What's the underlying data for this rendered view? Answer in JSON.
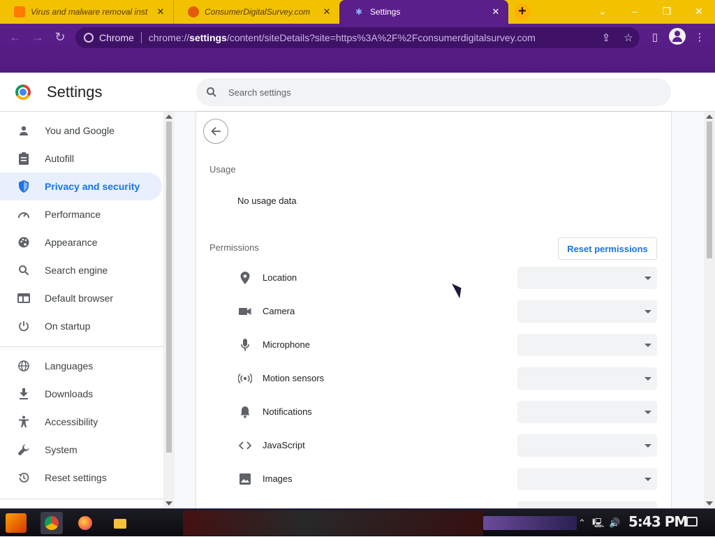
{
  "tabs": [
    {
      "title": "Virus and malware removal inst",
      "color": "#ff7a00",
      "active": false
    },
    {
      "title": "ConsumerDigitalSurvey.com",
      "color": "#e35a0a",
      "active": false
    },
    {
      "title": "Settings",
      "color": "#4285f4",
      "active": true
    }
  ],
  "new_tab_label": "+",
  "omnibox": {
    "chip": "Chrome",
    "url_prefix": "chrome://",
    "url_bold": "settings",
    "url_suffix": "/content/siteDetails?site=https%3A%2F%2Fconsumerdigitalsurvey.com"
  },
  "settings_header": {
    "title": "Settings",
    "search_placeholder": "Search settings"
  },
  "nav": {
    "items": [
      {
        "label": "You and Google",
        "icon": "person-icon"
      },
      {
        "label": "Autofill",
        "icon": "clipboard-icon"
      },
      {
        "label": "Privacy and security",
        "icon": "shield-icon",
        "active": true
      },
      {
        "label": "Performance",
        "icon": "gauge-icon"
      },
      {
        "label": "Appearance",
        "icon": "palette-icon"
      },
      {
        "label": "Search engine",
        "icon": "search-icon"
      },
      {
        "label": "Default browser",
        "icon": "browser-icon"
      },
      {
        "label": "On startup",
        "icon": "power-icon"
      },
      {
        "label": "Languages",
        "icon": "globe-icon"
      },
      {
        "label": "Downloads",
        "icon": "download-icon"
      },
      {
        "label": "Accessibility",
        "icon": "accessibility-icon"
      },
      {
        "label": "System",
        "icon": "wrench-icon"
      },
      {
        "label": "Reset settings",
        "icon": "history-icon"
      }
    ]
  },
  "site_details": {
    "usage_title": "Usage",
    "usage_text": "No usage data",
    "permissions_title": "Permissions",
    "reset_label": "Reset permissions",
    "permissions": [
      {
        "label": "Location",
        "icon": "location-pin-icon"
      },
      {
        "label": "Camera",
        "icon": "camera-icon"
      },
      {
        "label": "Microphone",
        "icon": "microphone-icon"
      },
      {
        "label": "Motion sensors",
        "icon": "motion-sensors-icon"
      },
      {
        "label": "Notifications",
        "icon": "bell-icon"
      },
      {
        "label": "JavaScript",
        "icon": "code-icon"
      },
      {
        "label": "Images",
        "icon": "image-icon"
      }
    ]
  },
  "taskbar": {
    "clock": "5:43 PM"
  },
  "colors": {
    "tabstrip": "#f2c200",
    "toolbar": "#5b1f8a",
    "accent": "#1a73e8"
  }
}
